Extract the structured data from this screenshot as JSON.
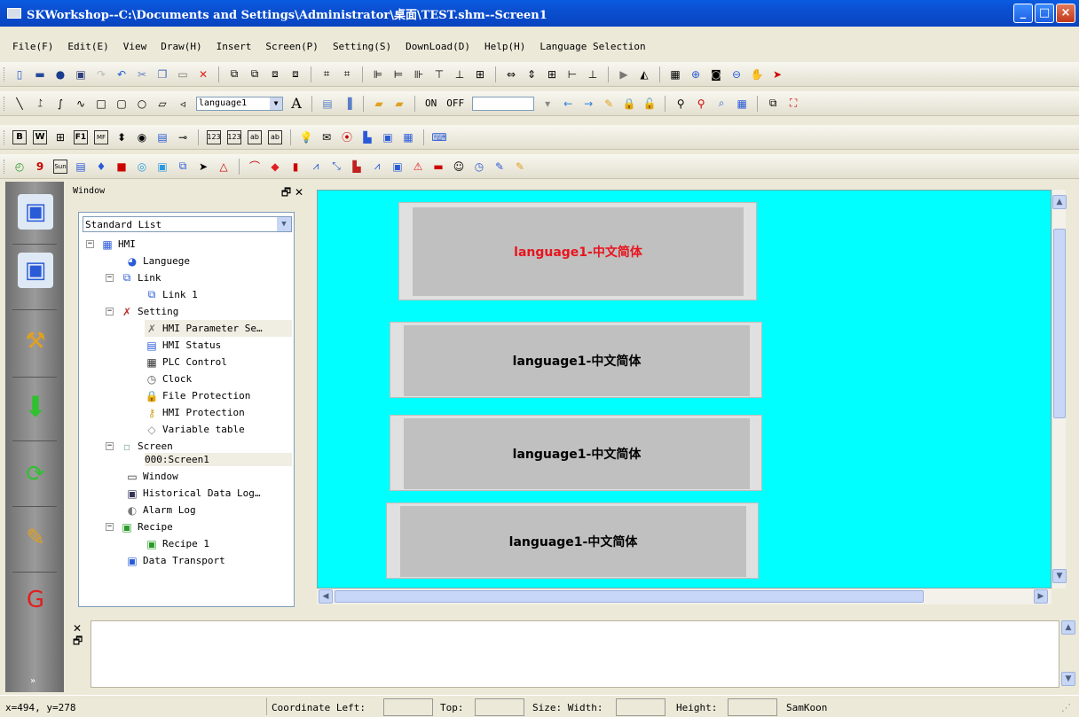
{
  "window": {
    "title": "SKWorkshop--C:\\Documents and Settings\\Administrator\\桌面\\TEST.shm--Screen1",
    "controls": [
      "_",
      "□",
      "×"
    ]
  },
  "menu": [
    "File(F)",
    "Edit(E)",
    "View",
    "Draw(H)",
    "Insert",
    "Screen(P)",
    "Setting(S)",
    "DownLoad(D)",
    "Help(H)",
    "Language Selection"
  ],
  "toolbar2": {
    "language_value": "language1",
    "text_tool": "A",
    "on_label": "ON",
    "off_label": "OFF"
  },
  "window_panel": {
    "title": "Window",
    "list_type": "Standard List",
    "tree": [
      {
        "label": "HMI"
      },
      {
        "label": "Languege"
      },
      {
        "label": "Link"
      },
      {
        "label": "Link 1"
      },
      {
        "label": "Setting"
      },
      {
        "label": "HMI Parameter Se…"
      },
      {
        "label": "HMI Status"
      },
      {
        "label": "PLC Control"
      },
      {
        "label": "Clock"
      },
      {
        "label": "File Protection"
      },
      {
        "label": "HMI Protection"
      },
      {
        "label": "Variable table"
      },
      {
        "label": "Screen"
      },
      {
        "label": "000:Screen1"
      },
      {
        "label": "Window"
      },
      {
        "label": "Historical Data Log…"
      },
      {
        "label": "Alarm Log"
      },
      {
        "label": "Recipe"
      },
      {
        "label": "Recipe 1"
      },
      {
        "label": "Data Transport"
      }
    ]
  },
  "canvas": {
    "background": "#00FFFF",
    "buttons": [
      {
        "label": "language1-中文简体",
        "color": "#E8141E"
      },
      {
        "label": "language1-中文简体",
        "color": "#000000"
      },
      {
        "label": "language1-中文简体",
        "color": "#000000"
      },
      {
        "label": "language1-中文简体",
        "color": "#000000"
      }
    ]
  },
  "status": {
    "coords": "x=494, y=278",
    "coordinate_label": "Coordinate Left:",
    "top_label": "Top:",
    "size_label": "Size: Width:",
    "height_label": "Height:",
    "brand": "SamKoon"
  }
}
